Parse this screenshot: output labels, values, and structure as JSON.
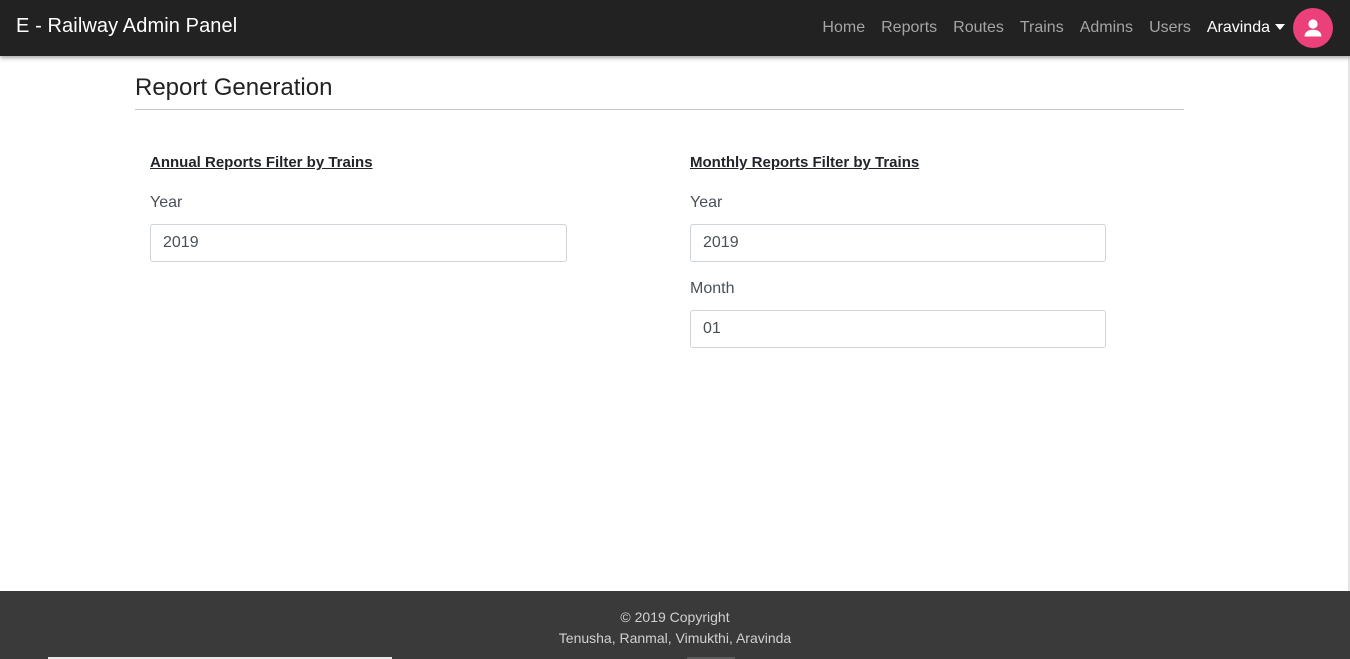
{
  "navbar": {
    "brand": "E - Railway Admin Panel",
    "links": [
      "Home",
      "Reports",
      "Routes",
      "Trains",
      "Admins",
      "Users"
    ],
    "user_name": "Aravinda",
    "avatar_icon": "user-icon",
    "avatar_color": "#ec407a"
  },
  "page": {
    "title": "Report Generation"
  },
  "annual": {
    "title": "Annual Reports Filter by Trains",
    "year_label": "Year",
    "year_value": "2019"
  },
  "monthly": {
    "title": "Monthly Reports Filter by Trains",
    "year_label": "Year",
    "year_value": "2019",
    "month_label": "Month",
    "month_value": "01"
  },
  "footer": {
    "copyright": "© 2019 Copyright",
    "authors": "Tenusha, Ranmal, Vimukthi, Aravinda"
  }
}
